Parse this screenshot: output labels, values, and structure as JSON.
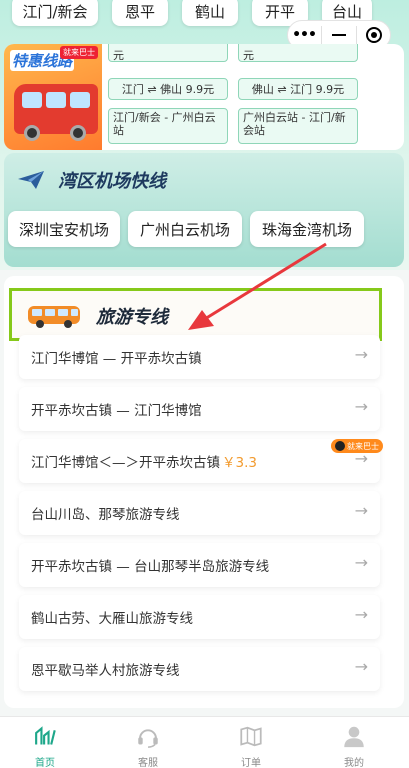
{
  "cities": [
    "江门/新会",
    "恩平",
    "鹤山",
    "开平",
    "台山"
  ],
  "discount": {
    "title": "特惠线路",
    "badge": "就来巴士",
    "routes": [
      "江门 ⇌ 佛山 9.9元",
      "佛山 ⇌ 江门 9.9元",
      "江门/新会 - 广州白云站",
      "广州白云站 - 江门/新会站"
    ],
    "partial_top_left": "元",
    "partial_top_right": "元"
  },
  "airport": {
    "title": "湾区机场快线",
    "buttons": [
      "深圳宝安机场",
      "广州白云机场",
      "珠海金湾机场"
    ]
  },
  "tour": {
    "title": "旅游专线",
    "items": [
      {
        "label": "江门华博馆 — 开平赤坎古镇",
        "price": ""
      },
      {
        "label": "开平赤坎古镇 — 江门华博馆",
        "price": ""
      },
      {
        "label": "江门华博馆＜—＞开平赤坎古镇",
        "price": "￥3.3"
      },
      {
        "label": "台山川岛、那琴旅游专线",
        "price": ""
      },
      {
        "label": "开平赤坎古镇 — 台山那琴半岛旅游专线",
        "price": ""
      },
      {
        "label": "鹤山古劳、大雁山旅游专线",
        "price": ""
      },
      {
        "label": "恩平歇马举人村旅游专线",
        "price": ""
      }
    ],
    "arrow": "→",
    "hot_badge": "就来巴士"
  },
  "tabbar": {
    "items": [
      {
        "label": "首页",
        "icon": "home-icon",
        "active": true
      },
      {
        "label": "客服",
        "icon": "headset-icon",
        "active": false
      },
      {
        "label": "订单",
        "icon": "map-icon",
        "active": false
      },
      {
        "label": "我的",
        "icon": "user-icon",
        "active": false
      }
    ]
  },
  "colors": {
    "accent": "#1ea78a",
    "highlight_border": "#86c91a",
    "price": "#f29b2f"
  }
}
